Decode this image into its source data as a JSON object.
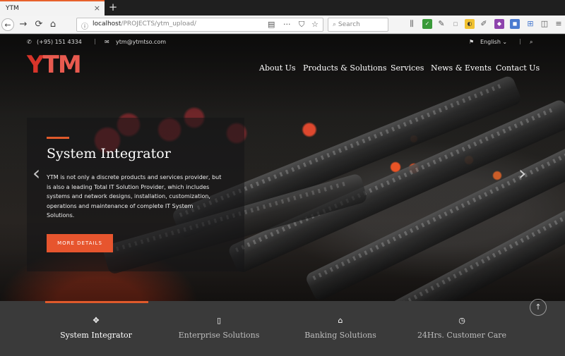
{
  "browser": {
    "tab": {
      "title": "YTM",
      "close_glyph": "×"
    },
    "new_tab_glyph": "+",
    "nav": {
      "back": "←",
      "forward": "→",
      "reload": "⟳",
      "home": "⌂"
    },
    "url": {
      "host": "localhost",
      "path": "/PROJECTS/ytm_upload/"
    },
    "search_placeholder": "Search",
    "url_actions": {
      "reader": "▤",
      "more": "···",
      "pocket": "⛉",
      "bookmark": "☆"
    }
  },
  "site": {
    "topbar": {
      "phone": "(+95) 151 4334",
      "email": "ytm@ytmtso.com",
      "language": "English ⌄"
    },
    "logo": {
      "y": "Y",
      "rest": "TM"
    },
    "menu": [
      "About Us",
      "Products & Solutions",
      "Services",
      "News & Events",
      "Contact Us"
    ],
    "slide": {
      "title": "System Integrator",
      "text": "YTM is not only a discrete products and services provider, but is also a leading Total IT Solution Provider, which includes systems and network designs, installation, customization, operations and maintenance of complete IT System Solutions.",
      "button": "MORE DETAILS"
    },
    "arrows": {
      "prev": "‹",
      "next": "›"
    },
    "features": [
      {
        "label": "System Integrator",
        "icon": "✥",
        "active": true
      },
      {
        "label": "Enterprise Solutions",
        "icon": "▯",
        "active": false
      },
      {
        "label": "Banking Solutions",
        "icon": "⌂",
        "active": false
      },
      {
        "label": "24Hrs. Customer Care",
        "icon": "◷",
        "active": false
      }
    ],
    "to_top": "↑",
    "colors": {
      "accent": "#e7552e",
      "logo_red": "#d8342a",
      "feature_bar": "#3a3a3a"
    }
  }
}
